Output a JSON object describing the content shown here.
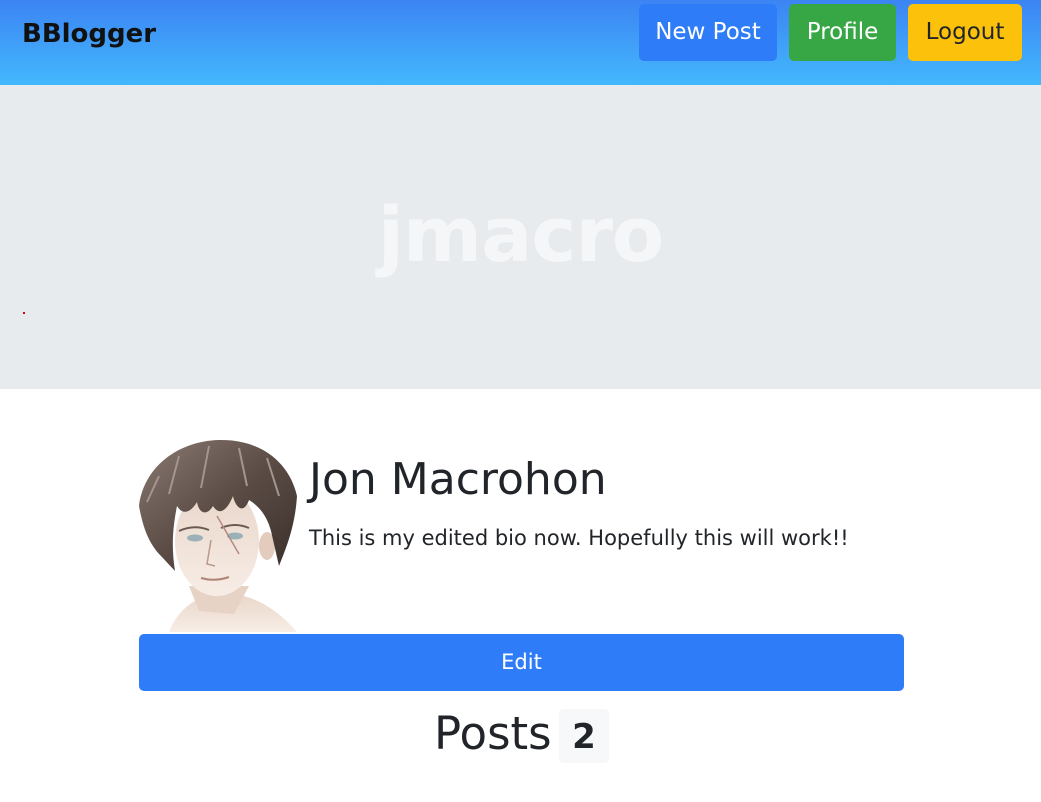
{
  "navbar": {
    "brand": "BBlogger",
    "buttons": {
      "new_post": "New Post",
      "profile": "Profile",
      "logout": "Logout"
    }
  },
  "banner": {
    "username": "jmacro"
  },
  "profile": {
    "avatar_icon": "user-avatar",
    "full_name": "Jon Macrohon",
    "bio": "This is my edited bio now. Hopefully this will work!!",
    "edit_label": "Edit"
  },
  "posts": {
    "title": "Posts",
    "count": "2"
  },
  "colors": {
    "primary": "#2e7cf7",
    "success": "#37a745",
    "warning": "#fcc10a",
    "jumbotron": "#e8ebee"
  }
}
